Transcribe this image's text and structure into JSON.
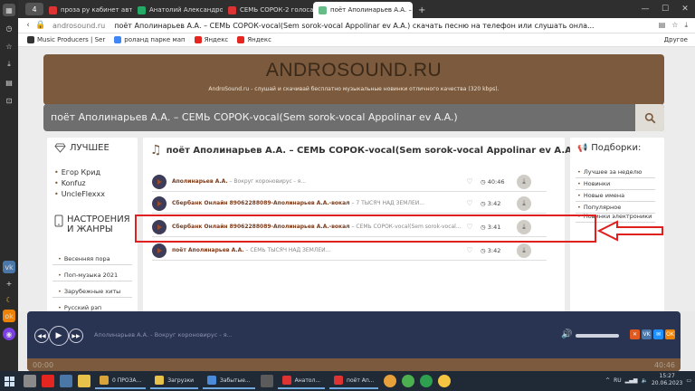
{
  "colors": {
    "brand": "#7b5a3d",
    "player": "#293352",
    "highlight": "#e0201e"
  },
  "browser": {
    "tab_count": "4",
    "tabs": [
      {
        "label": "проза ру кабинет автора",
        "fav": "#d33"
      },
      {
        "label": "Анатолий Александрович",
        "fav": "#2a6"
      },
      {
        "label": "СЕМЬ СОРОК-2 голоса ап",
        "fav": "#d33"
      },
      {
        "label": "поёт Аполинарьев А.А. – С",
        "fav": "#6b8",
        "active": true
      }
    ],
    "domain": "androsound.ru",
    "page_title": "поёт Аполинарьев А.А. – СЕМЬ СОРОК-vocal(Sem sorok-vocal Appolinar ev A.A.) скачать песню на телефон или слушать онла...",
    "bookmarks": [
      "Music Producers | Ser",
      "роланд парке мап",
      "Яндекс",
      "Яндекс"
    ],
    "other_bookmarks": "Другое"
  },
  "site": {
    "logo": "ANDROSOUND.RU",
    "tagline": "AndroSound.ru - слушай и скачивай бесплатно музыкальные новинки отличного качества (320 kbps).",
    "search_query": "поёт Аполинарьев А.А. – СЕМЬ СОРОК-vocal(Sem sorok-vocal Appolinar ev A.A.)"
  },
  "left": {
    "best_title": "ЛУЧШЕЕ",
    "artists": [
      "Егор Крид",
      "Konfuz",
      "UncleFlexxx"
    ],
    "genres_title": "НАСТРОЕНИЯ И ЖАНРЫ",
    "genres": [
      "Весенняя пора",
      "Поп-музыка 2021",
      "Зарубежные хиты",
      "Русский рэп"
    ]
  },
  "main": {
    "title": "поёт Аполинарьев А.А. – СЕМЬ СОРОК-vocal(Sem sorok-vocal Appolinar ev A.A.)",
    "tracks": [
      {
        "artist": "Аполинарьев А.А.",
        "song": " – Вокруг короновирус - я...",
        "duration": "40:46"
      },
      {
        "artist": "Сбербанк Онлайн 89062288089-Аполинарьев А.А.-вокал",
        "song": " – 7 ТЫСЯЧ НАД ЗЕМЛЕЙ...",
        "duration": "3:42"
      },
      {
        "artist": "Сбербанк Онлайн 89062288089-Аполинарьев А.А.-вокал",
        "song": " – СЕМЬ СОРОК-vocal(Sem sorok-vocal...",
        "duration": "3:41"
      },
      {
        "artist": "поёт Аполинарьев А.А.",
        "song": " – СЕМЬ ТЫСЯЧ НАД ЗЕМЛЕЙ...",
        "duration": "3:42"
      }
    ]
  },
  "right": {
    "title": "Подборки:",
    "links": [
      "Лучшее за неделю",
      "Новинки",
      "Новые имена",
      "Популярное",
      "Новинки электроники"
    ]
  },
  "player": {
    "track": "Аполинарьев А.А. - Вокруг короновирус - я...",
    "time_current": "00:00",
    "time_total": "40:46",
    "share": [
      {
        "label": "✕",
        "color": "#e05a1f"
      },
      {
        "label": "VK",
        "color": "#4a76a8"
      },
      {
        "label": "✉",
        "color": "#1e90ff"
      },
      {
        "label": "OK",
        "color": "#ee8208"
      }
    ]
  },
  "taskbar": {
    "items": [
      {
        "label": "0 ПРОЗА...",
        "color": "#d9a43a"
      },
      {
        "label": "Загрузки",
        "color": "#e8c14a"
      },
      {
        "label": "Забытые...",
        "color": "#4a8ad8"
      },
      {
        "label": "Анатол...",
        "color": "#d33"
      },
      {
        "label": "поёт Ап...",
        "color": "#d33"
      }
    ],
    "lang": "RU",
    "time": "15:27",
    "date": "20.06.2023"
  }
}
